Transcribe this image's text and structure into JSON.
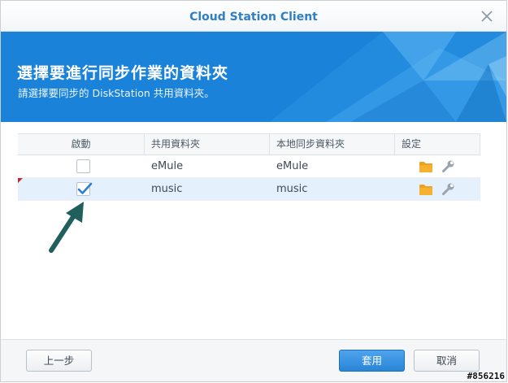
{
  "window": {
    "title": "Cloud Station Client",
    "close_icon": "close-icon"
  },
  "banner": {
    "title": "選擇要進行同步作業的資料夾",
    "subtitle": "請選擇要同步的 DiskStation 共用資料夾。",
    "color": "#1a83d9"
  },
  "grid": {
    "columns": [
      "啟動",
      "共用資料夾",
      "本地同步資料夾",
      "設定"
    ],
    "rows": [
      {
        "enabled": false,
        "shared_folder": "eMule",
        "local_folder": "eMule",
        "icons": [
          "folder-icon",
          "wrench-icon"
        ]
      },
      {
        "enabled": true,
        "shared_folder": "music",
        "local_folder": "music",
        "icons": [
          "folder-icon",
          "wrench-icon"
        ]
      }
    ],
    "selected_row": 1
  },
  "footer": {
    "back_label": "上一步",
    "apply_label": "套用",
    "cancel_label": "取消"
  },
  "watermark": "#856216",
  "colors": {
    "accent": "#2e7fc8",
    "primary_button": "#2a85d8",
    "selected_row": "#e4f0fb",
    "folder": "#f0a01a",
    "arrow": "#1f5f5c"
  }
}
